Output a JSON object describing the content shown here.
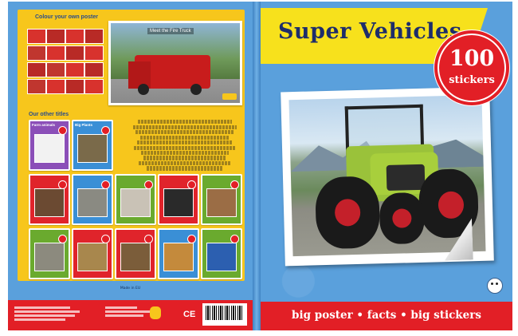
{
  "front": {
    "title": "Super Vehicles",
    "badge_number": "100",
    "badge_word": "stickers",
    "tagline": "big poster • facts • big stickers"
  },
  "back": {
    "section1_label": "Colour your own poster",
    "photo_caption": "Meet the Fire Truck",
    "section2_label": "Our other titles",
    "series_titles": [
      "Farm animals",
      "Big Plants",
      "",
      "",
      "",
      "",
      "",
      "",
      "",
      "",
      "",
      ""
    ],
    "imprint": "Made in EU"
  },
  "colors": {
    "background_blue": "#5aa0dc",
    "panel_yellow": "#f7c61c",
    "banner_yellow": "#f7e11c",
    "title_navy": "#1e2d6b",
    "footer_red": "#e21f26"
  }
}
